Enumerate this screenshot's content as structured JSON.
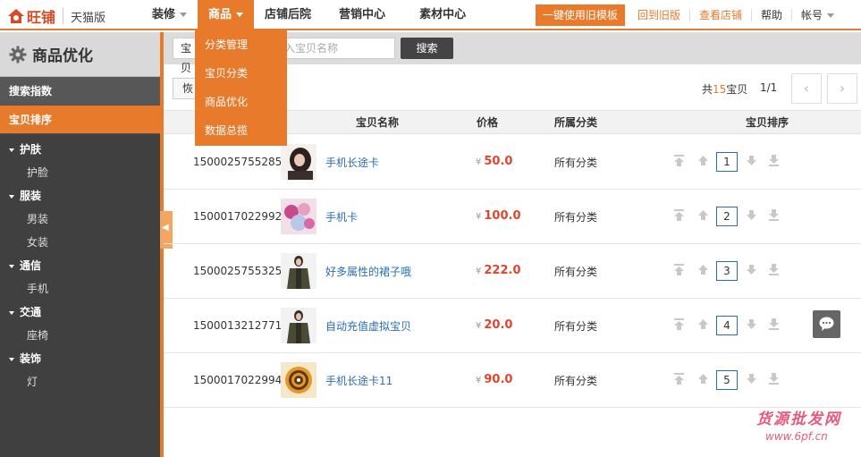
{
  "brand": {
    "name": "旺铺",
    "edition": "天猫版"
  },
  "nav": {
    "items": [
      {
        "label": "装修",
        "caret": true
      },
      {
        "label": "商品",
        "caret": true,
        "active": true
      },
      {
        "label": "店铺后院"
      },
      {
        "label": "营销中心"
      },
      {
        "label": "素材中心"
      }
    ]
  },
  "top_right": {
    "use_old_template": "一键使用旧模板",
    "back_to_old": "回到旧版",
    "view_store": "查看店铺",
    "help": "帮助",
    "account": "帐号"
  },
  "dropdown": {
    "items": [
      "分类管理",
      "宝贝分类",
      "商品优化",
      "数据总揽"
    ]
  },
  "sidebar": {
    "title": "商品优化",
    "rows": [
      {
        "label": "搜索指数"
      },
      {
        "label": "宝贝排序",
        "active": true
      }
    ],
    "categories": [
      {
        "label": "护肤",
        "children": [
          "护脸"
        ]
      },
      {
        "label": "服装",
        "children": [
          "男装",
          "女装"
        ]
      },
      {
        "label": "通信",
        "children": [
          "手机"
        ]
      },
      {
        "label": "交通",
        "children": [
          "座椅"
        ]
      },
      {
        "label": "装饰",
        "children": [
          "灯"
        ]
      }
    ]
  },
  "toolbar": {
    "select_label": "宝贝",
    "search_placeholder": "入宝贝名称",
    "search_button": "搜索",
    "restore_button": "恢",
    "total_prefix": "共",
    "total_count": "15",
    "total_suffix": "宝贝",
    "page": "1/1",
    "prev": "‹",
    "next": "›"
  },
  "table": {
    "headers": {
      "name": "宝贝名称",
      "price": "价格",
      "category": "所属分类",
      "rank": "宝贝排序"
    },
    "currency": "¥",
    "rows": [
      {
        "id": "1500025755285",
        "name": "手机长途卡",
        "price": "50.0",
        "category": "所有分类",
        "rank": "1",
        "thumb": "woman-hair"
      },
      {
        "id": "1500017022992",
        "name": "手机卡",
        "price": "100.0",
        "category": "所有分类",
        "rank": "2",
        "thumb": "flowers"
      },
      {
        "id": "1500025755325",
        "name": "好多属性的裙子哦",
        "price": "222.0",
        "category": "所有分类",
        "rank": "3",
        "thumb": "woman-coat"
      },
      {
        "id": "1500013212771",
        "name": "自动充值虚拟宝贝",
        "price": "20.0",
        "category": "所有分类",
        "rank": "4",
        "thumb": "woman-coat"
      },
      {
        "id": "1500017022994",
        "name": "手机长途卡11",
        "price": "90.0",
        "category": "所有分类",
        "rank": "5",
        "thumb": "spiral-disc"
      }
    ]
  },
  "watermark": {
    "line1": "货源批发网",
    "line2": "www.6pf.cn"
  },
  "colors": {
    "accent": "#e87a2b",
    "price": "#e0452b",
    "link": "#2a6db5",
    "sidebar_bg": "#404040"
  }
}
